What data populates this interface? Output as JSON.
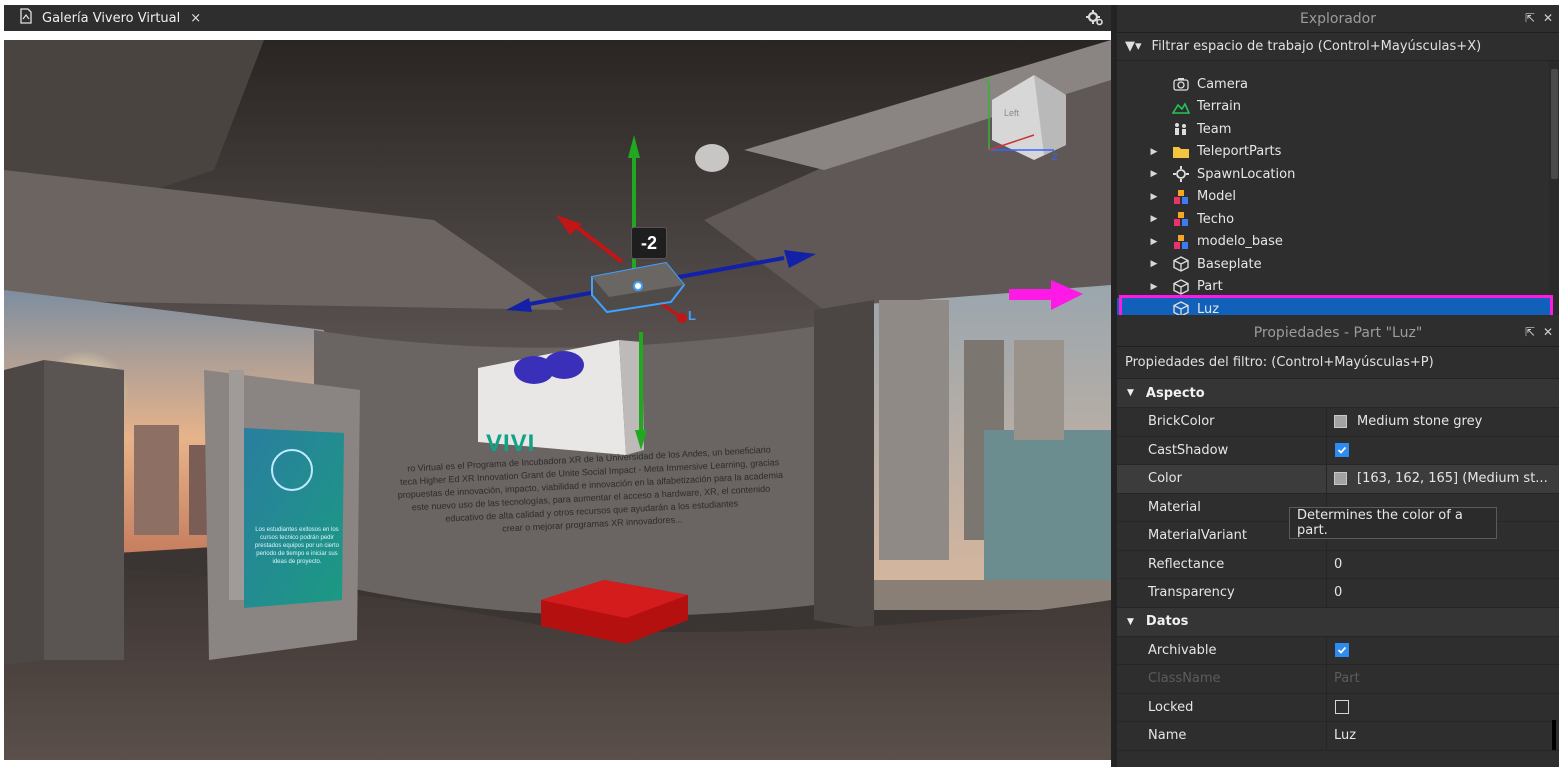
{
  "document_tab": {
    "title": "Galería Vivero Virtual",
    "close": "×"
  },
  "viewport": {
    "selection_size_label": "-2",
    "poster_lines": [
      "ro Virtual es el Programa de Incubadora XR de la Universidad de los Andes, un beneficiario",
      "teca Higher Ed XR Innovation Grant de Unite Social Impact - Meta Immersive Learning, gracias",
      "propuestas de innovación, impacto, viabilidad e innovación en la alfabetización para la academia",
      "este nuevo uso de las tecnologías, para aumentar el acceso a hardware, XR, el contenido",
      "educativo de alta calidad y otros recursos que ayudarán a los estudiantes",
      "crear o mejorar programas XR innovadores..."
    ],
    "logo_text": "VIVI",
    "kiosk_text": "Los estudiantes exitosos en los cursos tecnico podrán pedir prestados equipos por un cierto periodo de tiempo e iniciar sus ideas de proyecto.",
    "view_cube_face": "Left",
    "axis_y": "Y",
    "axis_z": "Z",
    "gizmo_label": "L"
  },
  "explorer": {
    "title": "Explorador",
    "filter": "Filtrar espacio de trabajo (Control+Mayúsculas+X)",
    "items": [
      {
        "label": "Camera",
        "icon": "camera-icon",
        "expandable": false
      },
      {
        "label": "Terrain",
        "icon": "terrain-icon",
        "expandable": false
      },
      {
        "label": "Team",
        "icon": "team-icon",
        "expandable": false
      },
      {
        "label": "TeleportParts",
        "icon": "folder-icon",
        "expandable": true
      },
      {
        "label": "SpawnLocation",
        "icon": "spawn-icon",
        "expandable": true
      },
      {
        "label": "Model",
        "icon": "model-icon",
        "expandable": true
      },
      {
        "label": "Techo",
        "icon": "model-icon",
        "expandable": true
      },
      {
        "label": "modelo_base",
        "icon": "model-icon",
        "expandable": true
      },
      {
        "label": "Baseplate",
        "icon": "part-icon",
        "expandable": true
      },
      {
        "label": "Part",
        "icon": "part-icon",
        "expandable": true
      },
      {
        "label": "Luz",
        "icon": "part-icon",
        "expandable": false,
        "selected": true
      }
    ]
  },
  "properties": {
    "title": "Propiedades - Part \"Luz\"",
    "filter": "Propiedades del filtro: (Control+Mayúsculas+P)",
    "sections": [
      {
        "name": "Aspecto",
        "rows": [
          {
            "name": "BrickColor",
            "type": "color",
            "value": "Medium stone grey"
          },
          {
            "name": "CastShadow",
            "type": "check",
            "checked": true
          },
          {
            "name": "Color",
            "type": "color",
            "value": "[163, 162, 165] (Medium st..."
          },
          {
            "name": "Material",
            "type": "text",
            "value": ""
          },
          {
            "name": "MaterialVariant",
            "type": "text",
            "value": ""
          },
          {
            "name": "Reflectance",
            "type": "text",
            "value": "0"
          },
          {
            "name": "Transparency",
            "type": "text",
            "value": "0"
          }
        ]
      },
      {
        "name": "Datos",
        "rows": [
          {
            "name": "Archivable",
            "type": "check",
            "checked": true
          },
          {
            "name": "ClassName",
            "type": "text",
            "value": "Part",
            "disabled": true
          },
          {
            "name": "Locked",
            "type": "check",
            "checked": false
          },
          {
            "name": "Name",
            "type": "text",
            "value": "Luz"
          }
        ]
      }
    ],
    "tooltip": "Determines the color of a part."
  },
  "colors": {
    "selection": "#1160b9",
    "highlight": "#ff19e6",
    "checkbox_on": "#2e8bf0",
    "swatch": "#a3a2a5"
  }
}
